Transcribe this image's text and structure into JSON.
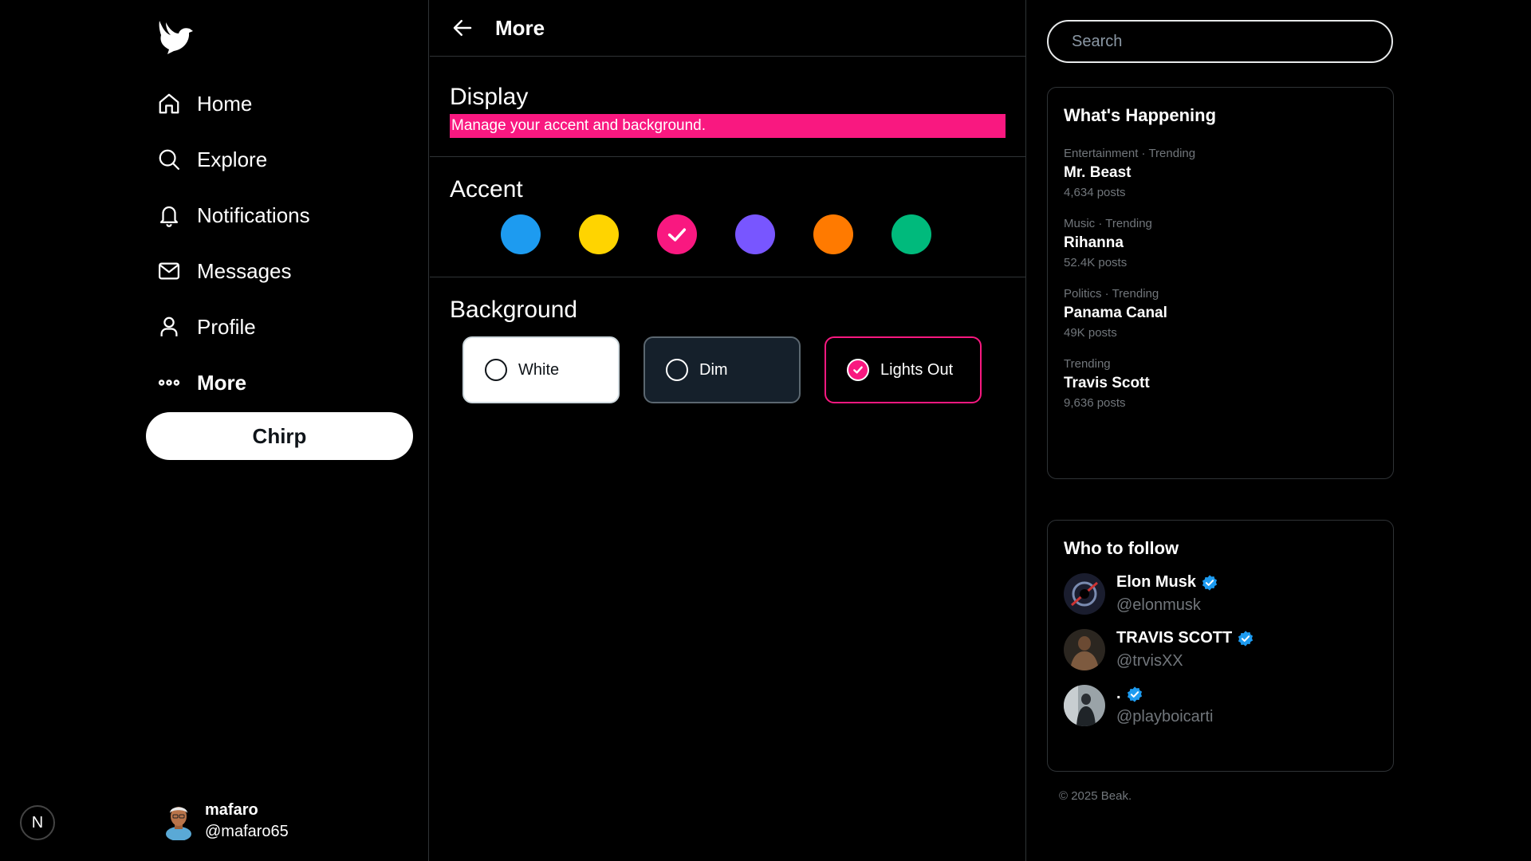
{
  "sidebar": {
    "items": [
      {
        "label": "Home",
        "icon": "home-icon"
      },
      {
        "label": "Explore",
        "icon": "search-icon"
      },
      {
        "label": "Notifications",
        "icon": "bell-icon"
      },
      {
        "label": "Messages",
        "icon": "mail-icon"
      },
      {
        "label": "Profile",
        "icon": "person-icon"
      },
      {
        "label": "More",
        "icon": "more-dots-icon",
        "active": true
      }
    ],
    "chirp_label": "Chirp",
    "badge": "N",
    "account": {
      "name": "mafaro",
      "handle": "@mafaro65"
    }
  },
  "main": {
    "header_title": "More",
    "display": {
      "title": "Display",
      "subtitle": "Manage your accent and background."
    },
    "accent": {
      "title": "Accent",
      "colors": [
        "#1d9bf0",
        "#ffd400",
        "#f91880",
        "#7856ff",
        "#ff7a00",
        "#00ba7c"
      ],
      "selected_index": 2
    },
    "background": {
      "title": "Background",
      "options": [
        "White",
        "Dim",
        "Lights Out"
      ],
      "selected": "Lights Out"
    }
  },
  "right": {
    "search_placeholder": "Search",
    "trends_title": "What's Happening",
    "trends": [
      {
        "meta": "Entertainment · Trending",
        "topic": "Mr. Beast",
        "count": "4,634 posts"
      },
      {
        "meta": "Music · Trending",
        "topic": "Rihanna",
        "count": "52.4K posts"
      },
      {
        "meta": "Politics · Trending",
        "topic": "Panama Canal",
        "count": "49K posts"
      },
      {
        "meta": "Trending",
        "topic": "Travis Scott",
        "count": "9,636 posts"
      }
    ],
    "follow_title": "Who to follow",
    "follow": [
      {
        "name": "Elon Musk",
        "handle": "@elonmusk"
      },
      {
        "name": "TRAVIS SCOTT",
        "handle": "@trvisXX"
      },
      {
        "name": ".",
        "handle": "@playboicarti"
      }
    ],
    "copyright": "© 2025 Beak."
  },
  "colors": {
    "accent": "#f91880",
    "verified": "#1d9bf0",
    "background": "#000000"
  }
}
